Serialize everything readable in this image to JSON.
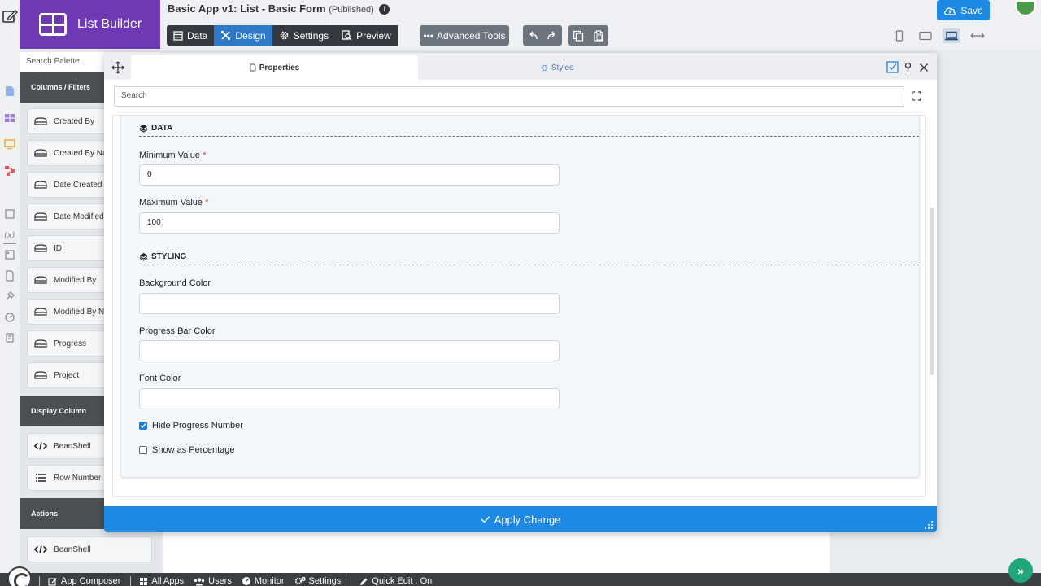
{
  "header": {
    "brand": "List Builder",
    "app_title": "Basic App v1: List - Basic Form",
    "app_status": "(Published)",
    "modes": [
      {
        "label": "Data"
      },
      {
        "label": "Design"
      },
      {
        "label": "Settings"
      },
      {
        "label": "Preview"
      }
    ],
    "active_mode": "Design",
    "advanced_tools": "Advanced Tools",
    "save": "Save",
    "accent_color": "#6d3ab4",
    "primary_color": "#1e88e5"
  },
  "palette": {
    "search_placeholder": "Search Palette",
    "categories": [
      {
        "title": "Columns / Filters",
        "items": [
          "Created By",
          "Created By Na",
          "Date Created",
          "Date Modified",
          "ID",
          "Modified By",
          "Modified By N",
          "Progress",
          "Project"
        ]
      },
      {
        "title": "Display Column",
        "items": [
          "BeanShell",
          "Row Number"
        ]
      },
      {
        "title": "Actions",
        "items": [
          "BeanShell"
        ]
      }
    ]
  },
  "dialog": {
    "tabs": [
      {
        "label": "Properties",
        "icon": "file-icon"
      },
      {
        "label": "Styles",
        "icon": "gear-icon"
      }
    ],
    "search_placeholder": "Search",
    "sections": {
      "data": {
        "title": "DATA",
        "min_label": "Minimum Value",
        "min_value": "0",
        "max_label": "Maximum Value",
        "max_value": "100",
        "required_mark": "*"
      },
      "styling": {
        "title": "STYLING",
        "bg_label": "Background Color",
        "bg_value": "",
        "bar_label": "Progress Bar Color",
        "bar_value": "",
        "font_label": "Font Color",
        "font_value": "",
        "hide_number_label": "Hide Progress Number",
        "hide_number_checked": true,
        "percentage_label": "Show as Percentage",
        "percentage_checked": false
      }
    },
    "apply": "Apply Change"
  },
  "bottom": {
    "items": [
      "App Composer",
      "All Apps",
      "Users",
      "Monitor",
      "Settings",
      "Quick Edit : On"
    ]
  }
}
